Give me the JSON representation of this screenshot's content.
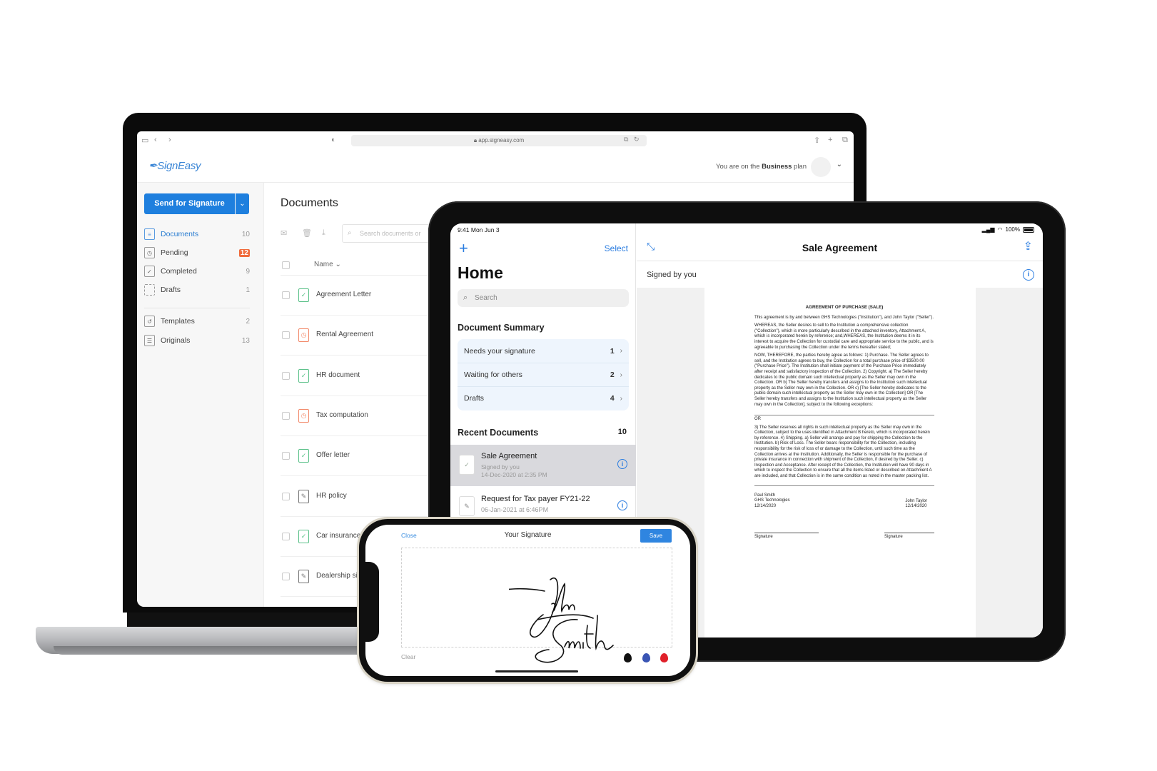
{
  "laptop": {
    "browser": {
      "url": "app.signeasy.com",
      "icons": [
        "sidebar-icon",
        "back-icon",
        "forward-icon",
        "shield-icon",
        "tabs-icon",
        "reload-icon",
        "share-icon",
        "new-tab-icon",
        "tab-overview-icon"
      ]
    },
    "header": {
      "logo": "SignEasy",
      "plan_prefix": "You are on the ",
      "plan_name": "Business",
      "plan_suffix": " plan"
    },
    "sidebar": {
      "send_button": "Send for Signature",
      "items": [
        {
          "label": "Documents",
          "count": "10",
          "icon": "documents-icon",
          "active": true
        },
        {
          "label": "Pending",
          "count": "12",
          "icon": "clock-icon",
          "highlight": true
        },
        {
          "label": "Completed",
          "count": "9",
          "icon": "check-icon"
        },
        {
          "label": "Drafts",
          "count": "1",
          "icon": "draft-icon"
        },
        {
          "label": "Templates",
          "count": "2",
          "icon": "template-icon"
        },
        {
          "label": "Originals",
          "count": "13",
          "icon": "original-icon"
        }
      ]
    },
    "main": {
      "title": "Documents",
      "search_placeholder": "Search documents or",
      "column_name": "Name",
      "documents": [
        {
          "name": "Agreement Letter",
          "status": "completed"
        },
        {
          "name": "Rental Agreement",
          "status": "pending"
        },
        {
          "name": "HR document",
          "status": "completed"
        },
        {
          "name": "Tax computation",
          "status": "pending"
        },
        {
          "name": "Offer letter",
          "status": "completed"
        },
        {
          "name": "HR policy",
          "status": "draft"
        },
        {
          "name": "Car insurance",
          "status": "completed"
        },
        {
          "name": "Dealership sign",
          "status": "draft"
        }
      ]
    }
  },
  "tablet": {
    "status": {
      "time": "9:41 Mon Jun 3",
      "battery": "100%"
    },
    "left": {
      "select": "Select",
      "title": "Home",
      "search_placeholder": "Search",
      "summary_title": "Document Summary",
      "summary": [
        {
          "label": "Needs your signature",
          "count": "1"
        },
        {
          "label": "Waiting for others",
          "count": "2"
        },
        {
          "label": "Drafts",
          "count": "4"
        }
      ],
      "recent_title": "Recent Documents",
      "recent_count": "10",
      "recent": [
        {
          "title": "Sale Agreement",
          "status": "Signed by you",
          "date": "14-Dec-2020 at 2:35 PM"
        },
        {
          "title": "Request for Tax payer FY21-22",
          "status": "",
          "date": "06-Jan-2021 at 6:46PM"
        }
      ]
    },
    "right": {
      "title": "Sale Agreement",
      "signed_by": "Signed by you",
      "document": {
        "heading": "AGREEMENT OF PURCHASE (SALE)",
        "p1": "This agreement is by and between GHS Technologies (\"Institution\"), and John Taylor (\"Seller\").",
        "p2": "WHEREAS, the Seller desires to sell to the Institution a comprehensive collection (\"Collection\"), which is more particularly described in the attached inventory, Attachment A, which is incorporated herein by reference; and,WHEREAS, the Institution deems it in its interest to acquire the Collection for custodial care and appropriate service to the public, and is agreeable to purchasing the Collection under the terms hereafter stated;",
        "p3": "NOW, THEREFORE, the parties hereby agree as follows: 1) Purchase. The Seller agrees to sell, and the Institution agrees to buy, the Collection for a total purchase price of $3500.00 (\"Purchase Price\"). The Institution shall initiate payment of the Purchase Price immediately after receipt and satisfactory inspection of the Collection. 2) Copyright. a) The Seller hereby dedicates to the public domain such intellectual property as the Seller may own in the Collection. OR b) The Seller hereby transfers and assigns to the Institution such intellectual property as the Seller may own in the Collection. OR c) [The Seller hereby dedicates to the public domain such intellectual property as the Seller may own in the Collection] OR [The Seller hereby transfers and assigns to the Institution such intellectual property as the Seller may own in the Collection], subject to the following exceptions:",
        "or": "OR",
        "p4": "3) The Seller reserves all rights in such intellectual property as the Seller may own in the Collection, subject to the uses identified in Attachment B hereto, which is incorporated herein by reference. 4) Shipping. a) Seller will arrange and pay for shipping the Collection to the Institution. b) Risk of Loss. The Seller bears responsibility for the Collection, including responsibility for the risk of loss of or damage to the Collection, until such time as the Collection arrives at the Institution. Additionally, the Seller is responsible for the purchase of private insurance in connection with shipment of the Collection, if desired by the Seller. c) Inspection and Acceptance. After receipt of the Collection, the Institution will have 90 days in which to inspect the Collection to ensure that all the items listed or described on Attachment A are included, and that Collection is in the same condition as noted in the master packing list.",
        "left_signer": {
          "name": "Paul Smith",
          "org": "GHS Technologies",
          "date": "12/14/2020"
        },
        "right_signer": {
          "name": "John Taylor",
          "date": "12/14/2020"
        },
        "signature_label": "Signature"
      }
    }
  },
  "phone": {
    "close": "Close",
    "title": "Your Signature",
    "save": "Save",
    "clear": "Clear",
    "signature_text": "John Smith",
    "ink_colors": [
      "#111111",
      "#3a55b4",
      "#e0202a"
    ],
    "accent": "#2f85e0"
  },
  "colors": {
    "primary": "#1e7fde",
    "ios_blue": "#2b7de0",
    "pending_badge": "#f06b3c",
    "completed": "#5cc18a",
    "pending": "#f28a6b"
  }
}
